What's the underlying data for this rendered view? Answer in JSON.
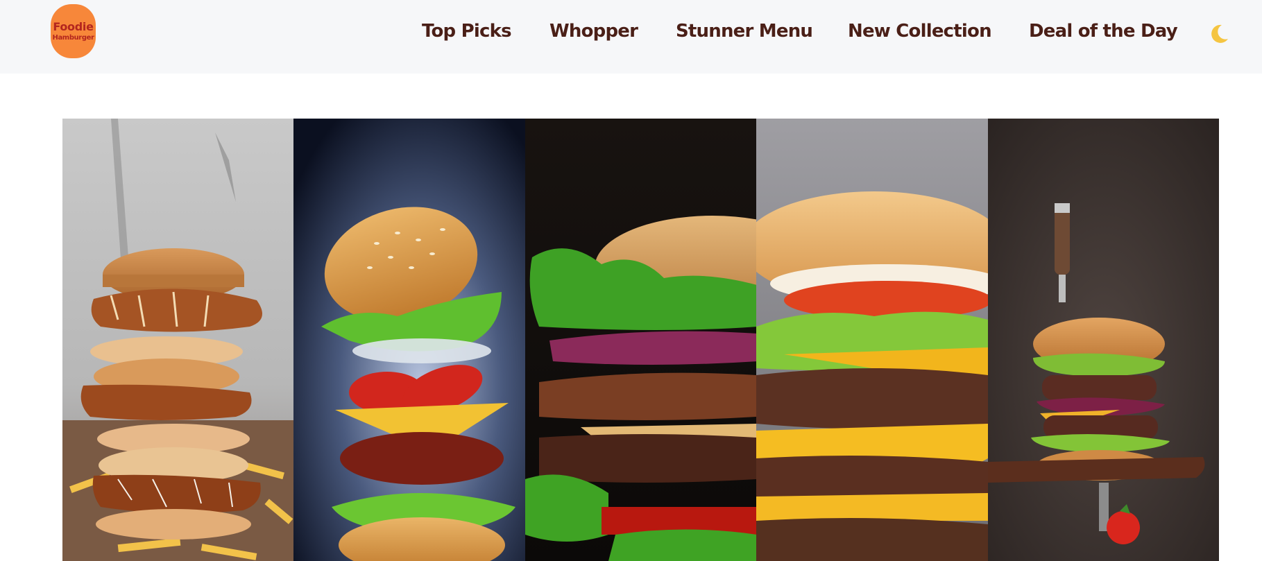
{
  "brand": {
    "line1": "Foodie",
    "line2": "Hamburger"
  },
  "nav": {
    "items": [
      {
        "label": "Top Picks"
      },
      {
        "label": "Whopper"
      },
      {
        "label": "Stunner Menu"
      },
      {
        "label": "New Collection"
      },
      {
        "label": "Deal of the Day"
      }
    ]
  },
  "theme_toggle": {
    "icon": "moon-icon"
  },
  "colors": {
    "nav_text": "#4a1f17",
    "logo_bg": "#f7873a",
    "logo_text": "#b3261e",
    "navbar_bg": "#f6f7f9"
  },
  "gallery": {
    "panels": [
      {
        "id": "burger-stack-fries"
      },
      {
        "id": "floating-burger"
      },
      {
        "id": "dark-burger-closeup"
      },
      {
        "id": "triple-cheeseburger"
      },
      {
        "id": "knife-burger-board"
      }
    ]
  }
}
